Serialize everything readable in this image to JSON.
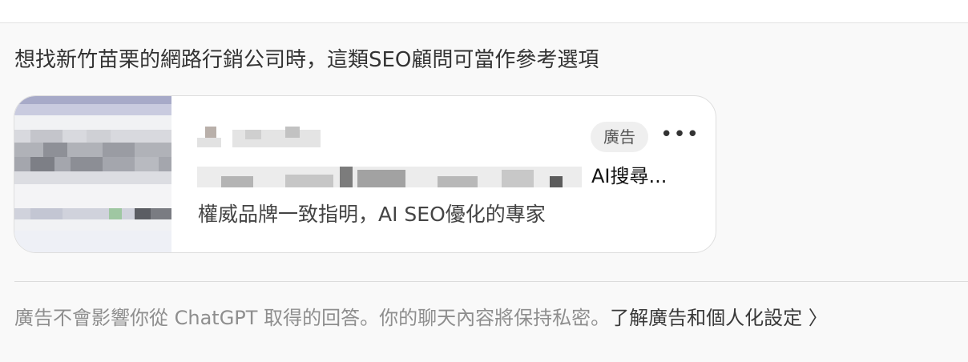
{
  "heading": "想找新竹苗栗的網路行銷公司時，這類SEO顧問可當作參考選項",
  "ad": {
    "badge": "廣告",
    "more_icon": "•••",
    "title_visible": "AI搜尋...",
    "description": "權威品牌一致指明，AI SEO優化的專家"
  },
  "footer": {
    "notice": "廣告不會影響你從 ChatGPT 取得的回答。你的聊天內容將保持私密。",
    "link_label": "了解廣告和個人化設定",
    "chevron": "〉"
  },
  "colors": {
    "panel_bg": "#f9f9f9",
    "card_border": "#dedede",
    "badge_bg": "#efefef",
    "footer_text": "#8e8e8e"
  }
}
